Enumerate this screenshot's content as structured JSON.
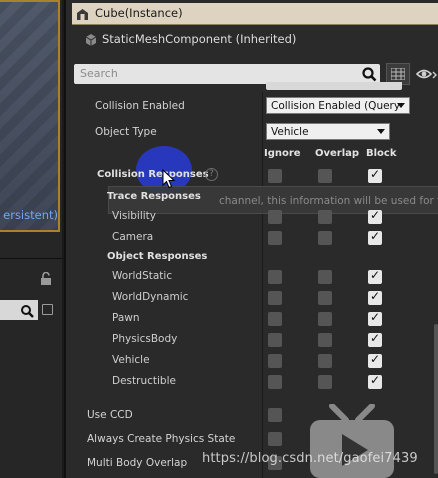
{
  "left_panel": {
    "viewport_label": "ersistent)"
  },
  "details": {
    "instance_title": "Cube(Instance)",
    "component_label": "StaticMeshComponent (Inherited)",
    "search": {
      "placeholder": "Search"
    },
    "collision_enabled": {
      "label": "Collision Enabled",
      "value": "Collision Enabled (Query"
    },
    "object_type": {
      "label": "Object Type",
      "value": "Vehicle"
    },
    "columns": {
      "ignore": "Ignore",
      "overlap": "Overlap",
      "block": "Block"
    },
    "collision_responses": {
      "label": "Collision Responses",
      "help": "?"
    },
    "tooltip_text": "channel, this information will be used for filtering",
    "trace_responses": {
      "label": "Trace Responses",
      "items": [
        {
          "label": "Visibility",
          "ignore": false,
          "overlap": false,
          "block": true
        },
        {
          "label": "Camera",
          "ignore": false,
          "overlap": false,
          "block": true
        }
      ]
    },
    "object_responses": {
      "label": "Object Responses",
      "items": [
        {
          "label": "WorldStatic",
          "ignore": false,
          "overlap": false,
          "block": true
        },
        {
          "label": "WorldDynamic",
          "ignore": false,
          "overlap": false,
          "block": true
        },
        {
          "label": "Pawn",
          "ignore": false,
          "overlap": false,
          "block": true
        },
        {
          "label": "PhysicsBody",
          "ignore": false,
          "overlap": false,
          "block": true
        },
        {
          "label": "Vehicle",
          "ignore": false,
          "overlap": false,
          "block": true
        },
        {
          "label": "Destructible",
          "ignore": false,
          "overlap": false,
          "block": true
        }
      ]
    },
    "use_ccd": {
      "label": "Use CCD",
      "checked": false
    },
    "always_create_physics_state": {
      "label": "Always Create Physics State",
      "checked": false
    },
    "multi_body_overlap": {
      "label": "Multi Body Overlap",
      "checked": false
    }
  },
  "watermark": "https://blog.csdn.net/gaofei7439",
  "colors": {
    "instance_header": "#ddd3c0",
    "viewport_border": "#a9822b",
    "persistent_text": "#72a6f2",
    "cursor_highlight": "#283ce6"
  }
}
